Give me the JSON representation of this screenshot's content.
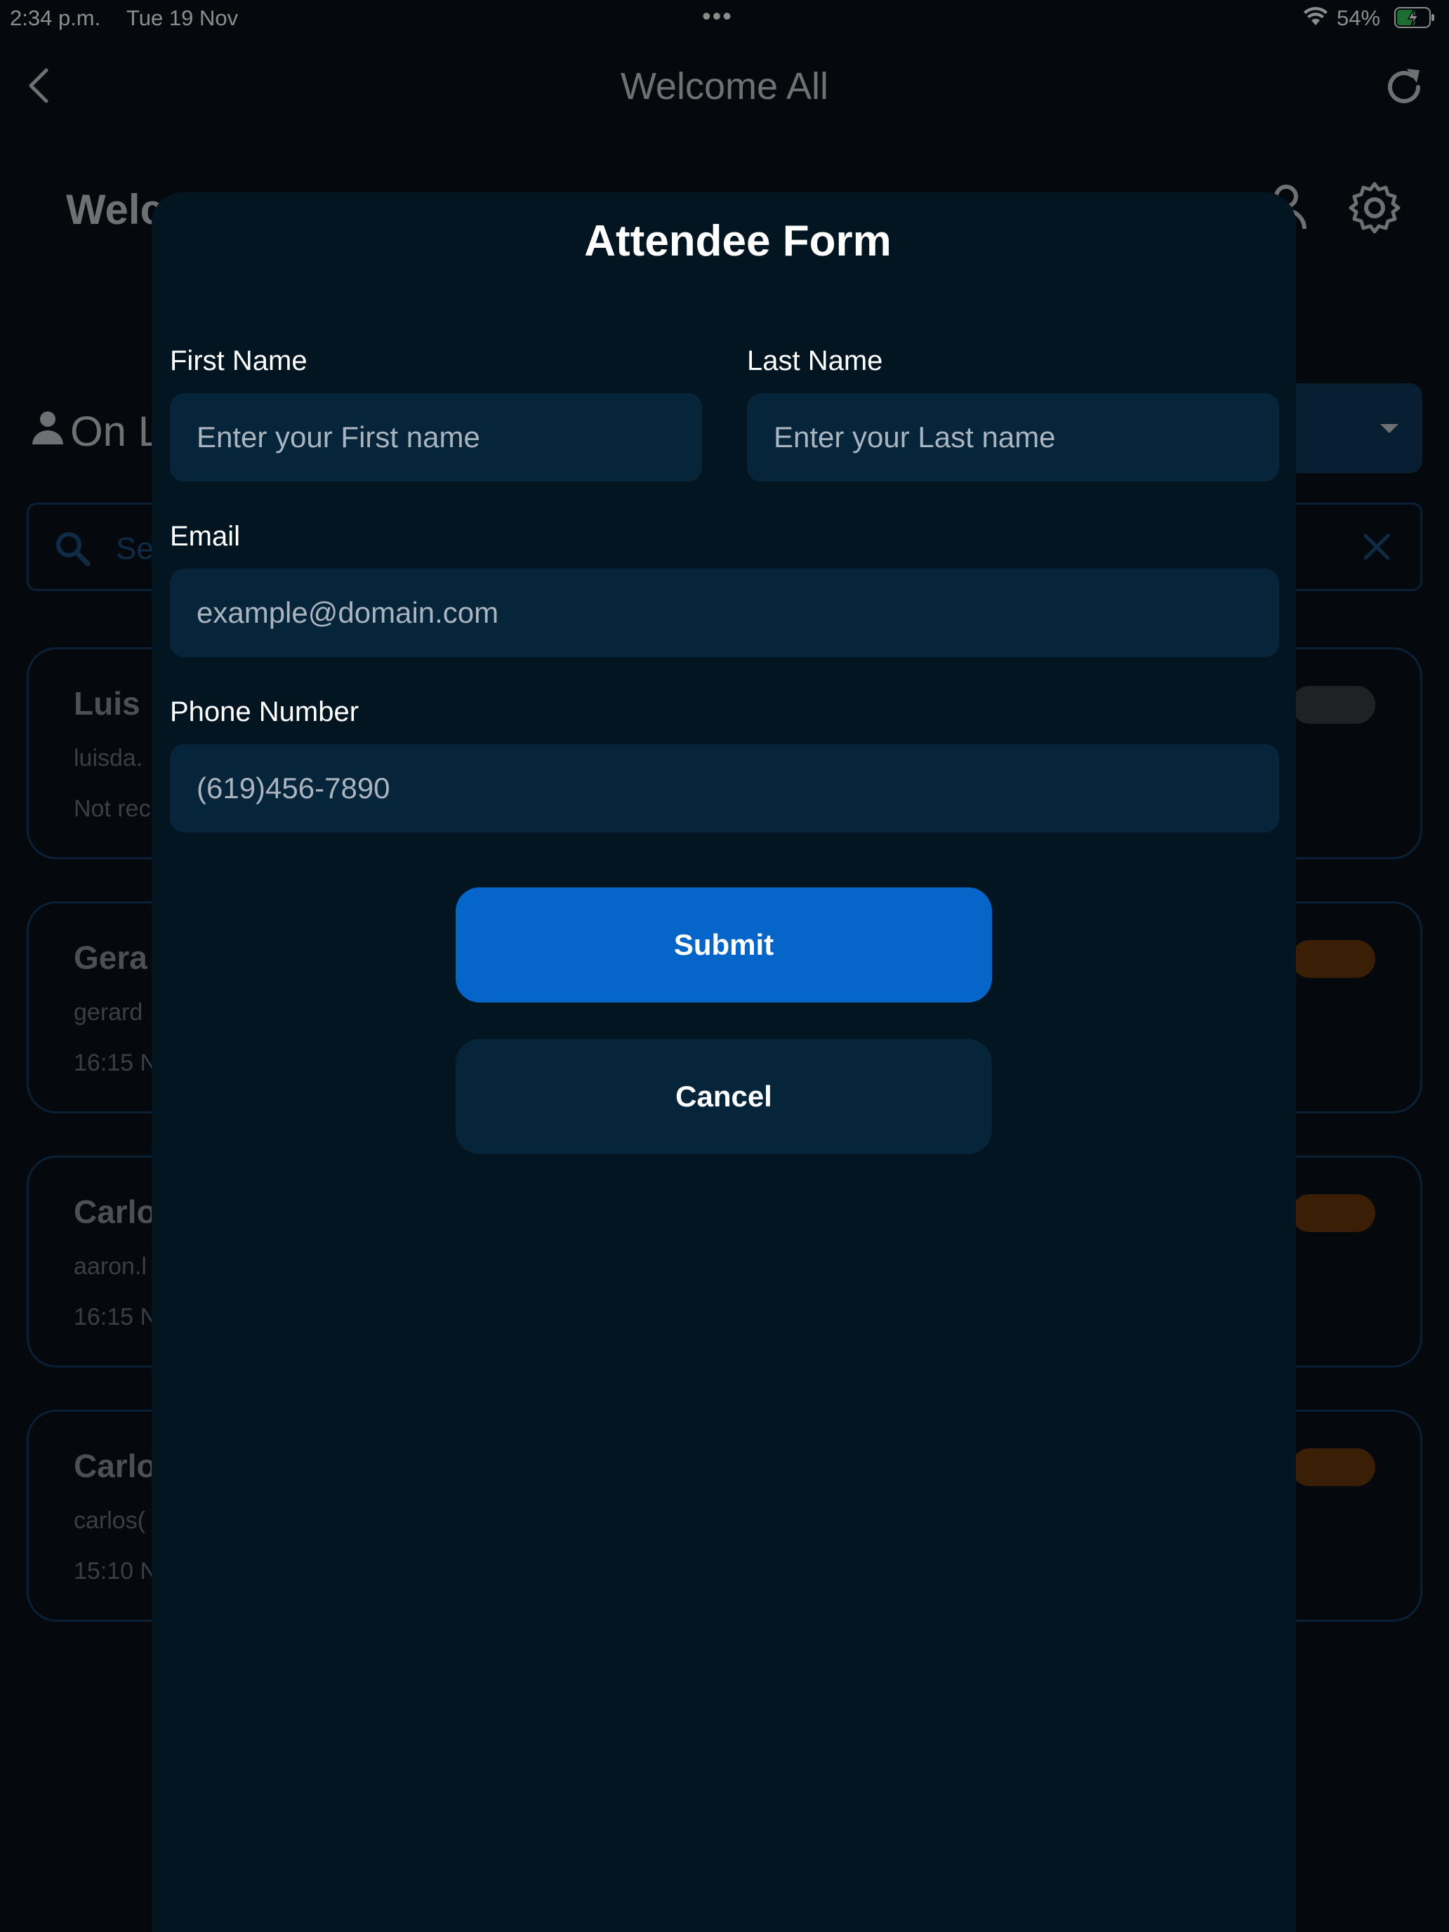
{
  "status_bar": {
    "time": "2:34 p.m.",
    "date": "Tue 19 Nov",
    "more_dots": "•••",
    "battery_percent": "54%"
  },
  "nav": {
    "title": "Welcome All"
  },
  "background": {
    "welcome_heading": "Welc",
    "section_heading": "On L",
    "search_placeholder": "Se",
    "attendees": [
      {
        "name": "Luis",
        "email": "luisda.",
        "time": "Not rec",
        "badge_color": "#3a3e44"
      },
      {
        "name": "Gera",
        "email": "gerard",
        "time": "16:15 N",
        "badge_color": "#6b3a0c"
      },
      {
        "name": "Carlo",
        "email": "aaron.l",
        "time": "16:15 N",
        "badge_color": "#6b3a0c"
      },
      {
        "name": "Carlo",
        "email": "carlos(",
        "time": "15:10 N",
        "badge_color": "#6b3a0c"
      }
    ]
  },
  "modal": {
    "title": "Attendee Form",
    "first_name": {
      "label": "First Name",
      "placeholder": "Enter your First name",
      "value": ""
    },
    "last_name": {
      "label": "Last Name",
      "placeholder": "Enter your Last name",
      "value": ""
    },
    "email": {
      "label": "Email",
      "placeholder": "example@domain.com",
      "value": ""
    },
    "phone": {
      "label": "Phone Number",
      "placeholder": "(619)456-7890",
      "value": ""
    },
    "submit_label": "Submit",
    "cancel_label": "Cancel"
  },
  "colors": {
    "accent": "#0665c8",
    "modal_bg": "#021520",
    "input_bg": "#06243a",
    "card_border": "#123b63",
    "battery_charging": "#34c759"
  }
}
